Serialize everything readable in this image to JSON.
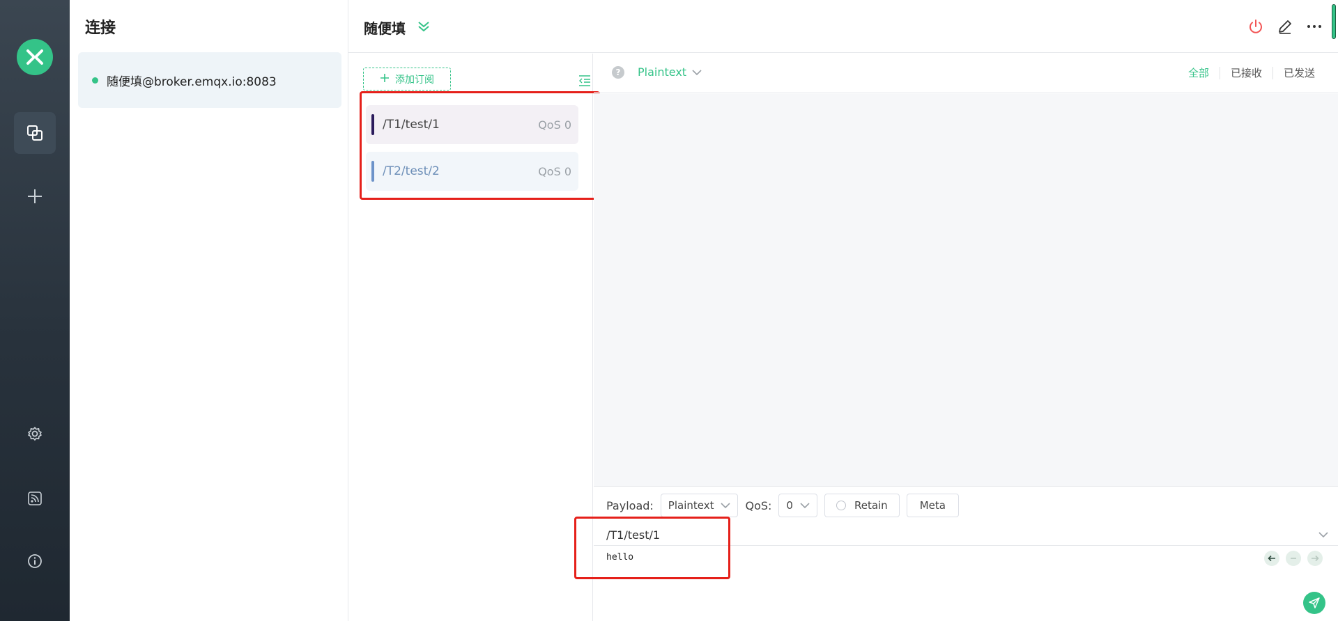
{
  "sidebar": {
    "logo": "mqttx-logo-icon",
    "items": [
      {
        "name": "connections-icon",
        "active": true
      },
      {
        "name": "plus-icon"
      },
      {
        "name": "gear-icon"
      },
      {
        "name": "rss-icon"
      },
      {
        "name": "info-icon"
      }
    ]
  },
  "connections": {
    "title": "连接",
    "items": [
      {
        "name": "随便填@broker.emqx.io:8083",
        "status": "connected"
      }
    ]
  },
  "header": {
    "title": "随便填",
    "icons": [
      "power-icon",
      "edit-icon",
      "more-icon"
    ]
  },
  "subscriptions": {
    "add_label": "添加订阅",
    "items": [
      {
        "topic": "/T1/test/1",
        "qos": "QoS 0",
        "color": "#2b1b5c",
        "bg": "#f3f0f5",
        "text_color": "#444444"
      },
      {
        "topic": "/T2/test/2",
        "qos": "QoS 0",
        "color": "#6d93c9",
        "bg": "#f2f6fa",
        "text_color": "#6d8fb8"
      }
    ]
  },
  "messages": {
    "help": "?",
    "format": "Plaintext",
    "filters": [
      "全部",
      "已接收",
      "已发送"
    ],
    "active_filter": "全部"
  },
  "publish": {
    "payload_label": "Payload:",
    "payload_format": "Plaintext",
    "qos_label": "QoS:",
    "qos_value": "0",
    "retain_label": "Retain",
    "meta_label": "Meta",
    "topic": "/T1/test/1",
    "payload": "hello"
  },
  "colors": {
    "accent": "#34c388",
    "highlight": "#e5201a"
  }
}
